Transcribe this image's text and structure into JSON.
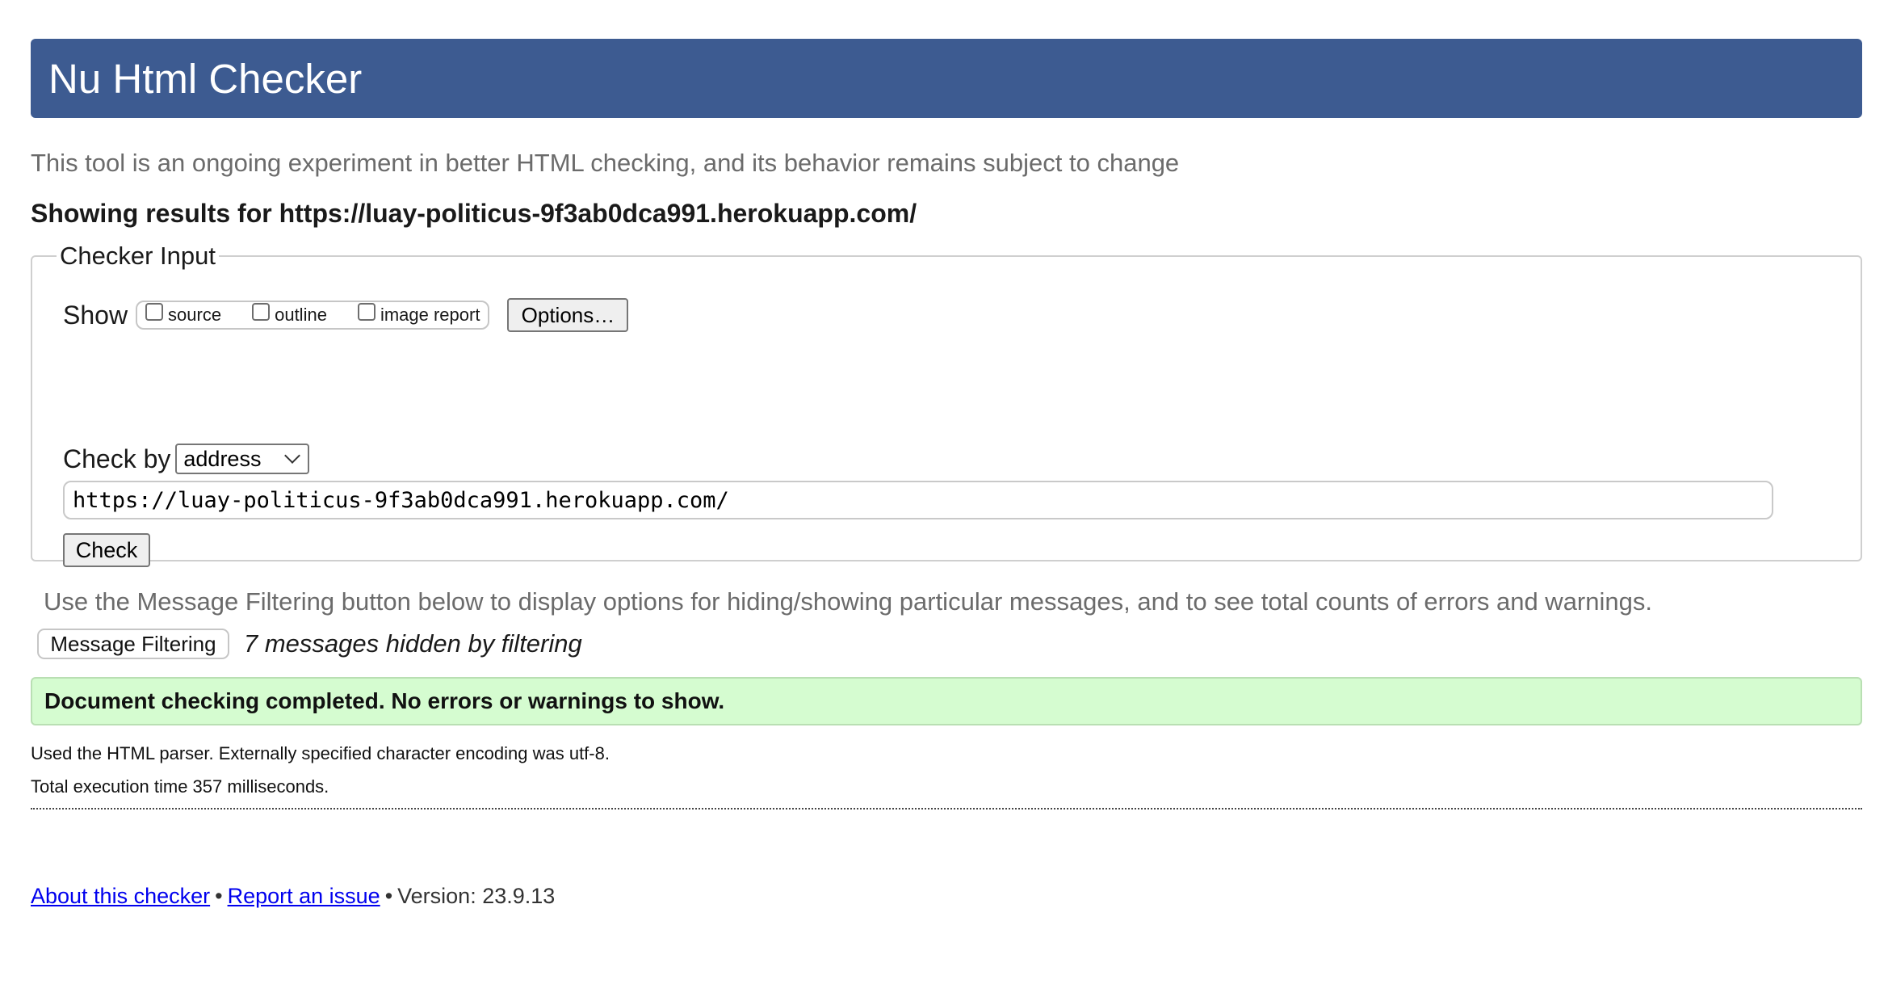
{
  "header": {
    "title": "Nu Html Checker"
  },
  "tagline": "This tool is an ongoing experiment in better HTML checking, and its behavior remains subject to change",
  "showing_results": "Showing results for https://luay-politicus-9f3ab0dca991.herokuapp.com/",
  "checker_input": {
    "legend": "Checker Input",
    "show_label": "Show",
    "show_options": [
      {
        "label": "source",
        "checked": false
      },
      {
        "label": "outline",
        "checked": false
      },
      {
        "label": "image report",
        "checked": false
      }
    ],
    "options_button": "Options…",
    "check_by_label": "Check by",
    "check_by_selected": "address",
    "url_value": "https://luay-politicus-9f3ab0dca991.herokuapp.com/",
    "check_button": "Check"
  },
  "filtering": {
    "hint": "Use the Message Filtering button below to display options for hiding/showing particular messages, and to see total counts of errors and warnings.",
    "button": "Message Filtering",
    "hidden_count": "7 messages hidden by filtering"
  },
  "result": {
    "status": "Document checking completed. No errors or warnings to show.",
    "status_color": "#d5fcd0",
    "parser_info": "Used the HTML parser. Externally specified character encoding was utf-8.",
    "execution_time": "Total execution time 357 milliseconds."
  },
  "footer": {
    "about_link": "About this checker",
    "separator": "•",
    "report_link": "Report an issue",
    "version": "Version: 23.9.13"
  },
  "colors": {
    "header_bg": "#3d5b91",
    "link": "#0000ee"
  }
}
